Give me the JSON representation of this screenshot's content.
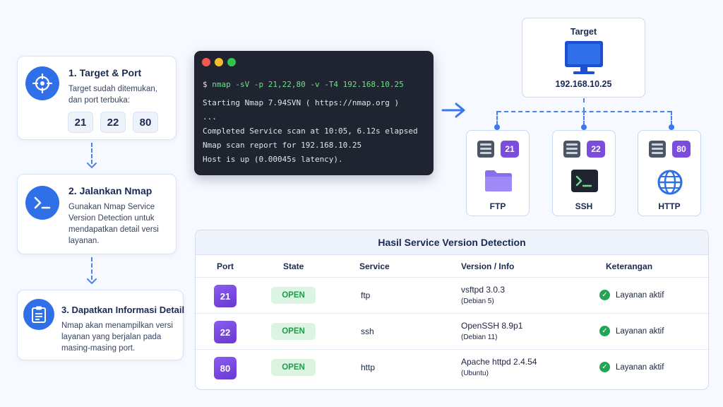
{
  "steps": [
    {
      "title": "1. Target & Port",
      "desc": "Target sudah ditemukan, dan port terbuka:",
      "ports": [
        "21",
        "22",
        "80"
      ]
    },
    {
      "title": "2. Jalankan Nmap",
      "desc": "Gunakan Nmap Service Version Detection untuk mendapatkan detail versi layanan."
    },
    {
      "title": "3. Dapatkan Informasi Detail",
      "desc": "Nmap akan menampilkan versi layanan yang berjalan pada masing-masing port."
    }
  ],
  "terminal": {
    "prompt": "$ ",
    "command": "nmap -sV -p 21,22,80 -v -T4 192.168.10.25",
    "lines": [
      "Starting Nmap 7.94SVN ( https://nmap.org )",
      "...",
      "Completed Service scan at 10:05, 6.12s elapsed",
      "Nmap scan report for 192.168.10.25",
      "Host is up (0.00045s latency)."
    ]
  },
  "target": {
    "label": "Target",
    "ip": "192.168.10.25"
  },
  "services": [
    {
      "port": "21",
      "name": "FTP",
      "icon": "folder-icon"
    },
    {
      "port": "22",
      "name": "SSH",
      "icon": "terminal-icon"
    },
    {
      "port": "80",
      "name": "HTTP",
      "icon": "globe-icon"
    }
  ],
  "results": {
    "title": "Hasil Service Version Detection",
    "headers": [
      "Port",
      "State",
      "Service",
      "Version / Info",
      "Keterangan"
    ],
    "rows": [
      {
        "port": "21",
        "state": "OPEN",
        "service": "ftp",
        "version": "vsftpd 3.0.3",
        "info": "(Debian 5)",
        "note": "Layanan aktif"
      },
      {
        "port": "22",
        "state": "OPEN",
        "service": "ssh",
        "version": "OpenSSH 8.9p1",
        "info": "(Debian 11)",
        "note": "Layanan aktif"
      },
      {
        "port": "80",
        "state": "OPEN",
        "service": "http",
        "version": "Apache httpd 2.4.54",
        "info": "(Ubuntu)",
        "note": "Layanan aktif"
      }
    ]
  },
  "colors": {
    "accent": "#2f6fe8",
    "port_badge": "#7c4ddd",
    "open_bg": "#dcf5e2",
    "open_text": "#1f9c4a",
    "terminal_bg": "#1f2430",
    "command": "#6ee08a"
  }
}
